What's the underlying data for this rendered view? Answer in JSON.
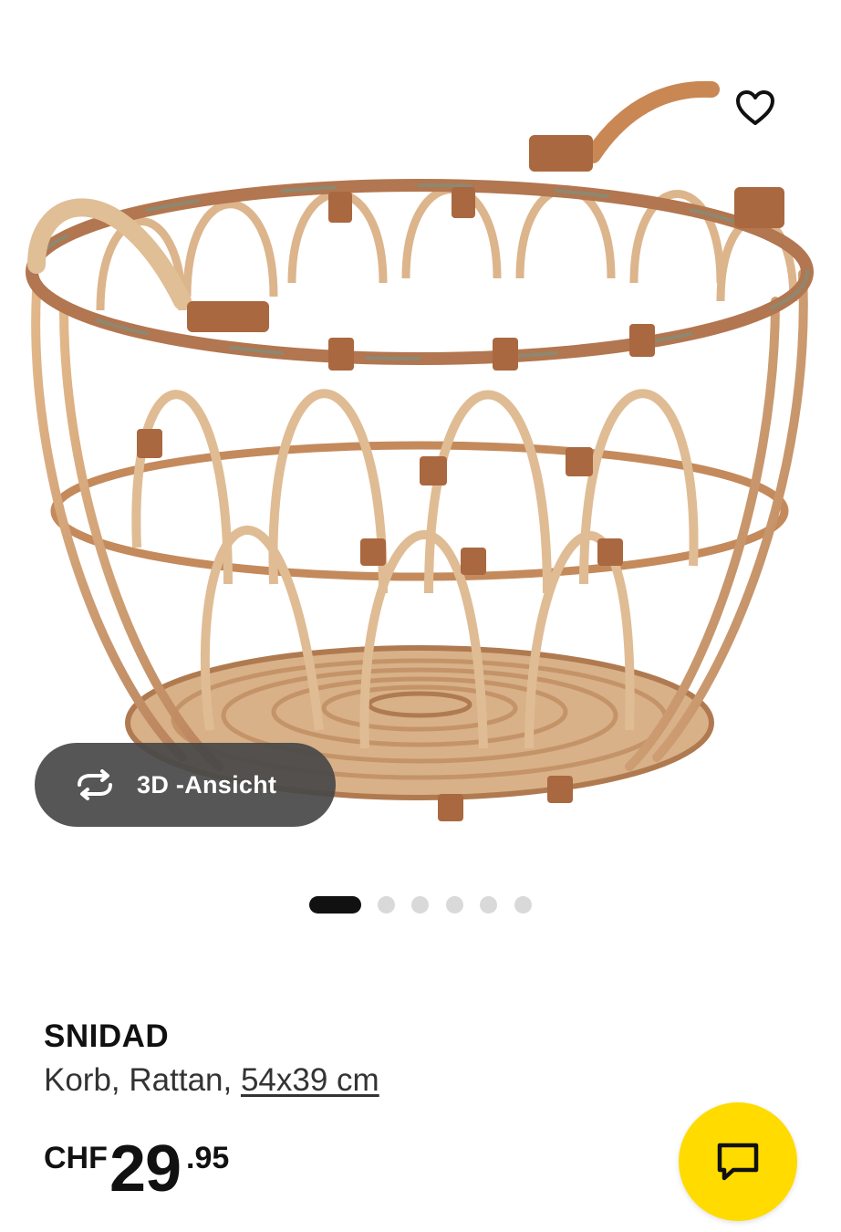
{
  "gallery": {
    "image_alt": "SNIDAD Korb, Rattan",
    "favorite_icon": "heart-outline-icon",
    "view_3d": {
      "icon": "rotate-arrows-icon",
      "label": "3D -Ansicht"
    },
    "pager": {
      "total": 6,
      "active_index": 0
    }
  },
  "product": {
    "name": "SNIDAD",
    "description_prefix": "Korb, Rattan, ",
    "size_link": "54x39 cm",
    "price": {
      "currency": "CHF",
      "integer": "29",
      "decimals": ".95"
    }
  },
  "chat": {
    "icon": "chat-bubble-icon"
  },
  "colors": {
    "chat_button": "#ffdb00",
    "pill_background": "#484848",
    "active_dot": "#111111",
    "inactive_dot": "#d9d9d9"
  }
}
